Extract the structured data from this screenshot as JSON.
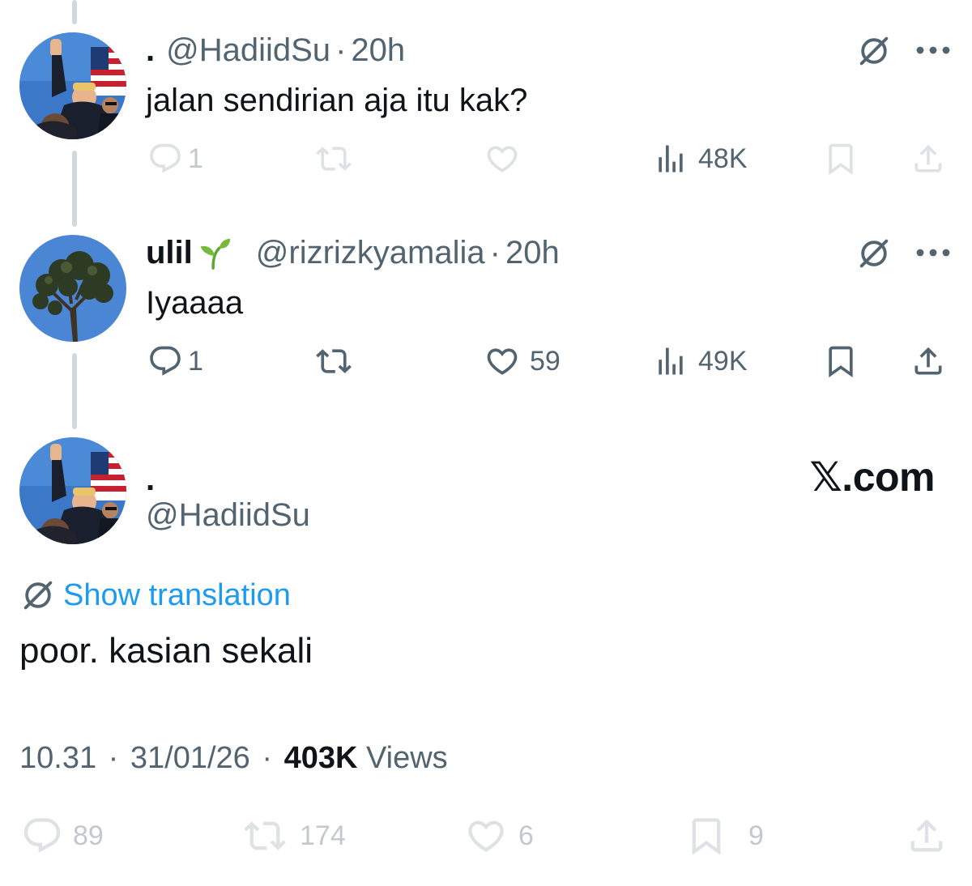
{
  "colors": {
    "accent": "#1d9bf0",
    "text_primary": "#0f1419",
    "text_secondary": "#536471",
    "thread_line": "#cfd9de"
  },
  "reply1": {
    "display_name": ".",
    "handle": "@HadiidSu",
    "separator": "·",
    "time": "20h",
    "text": "jalan sendirian aja itu kak?",
    "avatar_icon": "avatar-photo-raised-fist",
    "translate_icon": "translate-globe-icon",
    "more_icon": "more-dots-icon",
    "actions": {
      "reply": "1",
      "repost": "",
      "like": "",
      "views": "48K"
    }
  },
  "reply2": {
    "display_name": "ulil",
    "emoji": "sprout-icon",
    "handle": "@rizrizkyamalia",
    "separator": "·",
    "time": "20h",
    "text": "Iyaaaa",
    "avatar_icon": "avatar-photo-tree",
    "actions": {
      "reply": "1",
      "repost": "",
      "like": "59",
      "views": "49K"
    }
  },
  "main_tweet": {
    "display_name": ".",
    "handle": "@HadiidSu",
    "watermark": "𝕏.com",
    "show_translation": "Show translation",
    "text": "poor. kasian sekali",
    "time": "10.31",
    "date": "31/01/26",
    "separator": "·",
    "views_count": "403K",
    "views_label": "Views",
    "actions": {
      "reply": "89",
      "repost": "174",
      "like": "6",
      "bookmark": "9"
    }
  }
}
